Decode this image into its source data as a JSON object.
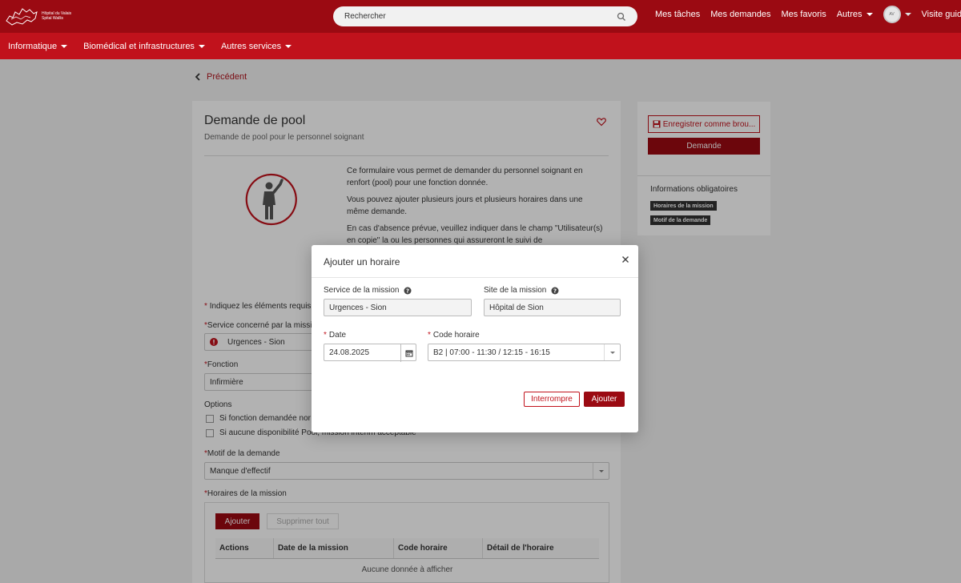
{
  "header": {
    "logo_line1": "Hôpital du Valais",
    "logo_line2": "Spital Wallis",
    "search_placeholder": "Rechercher",
    "nav": [
      "Mes tâches",
      "Mes demandes",
      "Mes favoris",
      "Autres"
    ],
    "avatar_initials": "AV",
    "guided_tour": "Visite guidée"
  },
  "subnav": [
    "Informatique",
    "Biomédical et infrastructures",
    "Autres services"
  ],
  "page": {
    "back_label": "Précédent",
    "title": "Demande de pool",
    "subtitle": "Demande de pool pour le personnel soignant",
    "intro": [
      "Ce formulaire vous permet de demander du personnel soignant en renfort (pool) pour une fonction donnée.",
      "Vous pouvez ajouter plusieurs jours et plusieurs horaires dans une même demande.",
      "En cas d'absence prévue, veuillez indiquer dans le champ \"Utilisateur(s) en copie\" la ou les personnes qui assureront le suivi de"
    ],
    "required_note": "Indiquez les éléments requis",
    "service_label": "Service concerné par la missi",
    "service_value": "Urgences - Sion",
    "fonction_label": "Fonction",
    "fonction_value": "Infirmière",
    "options_label": "Options",
    "option1": "Si fonction demandée nor",
    "option2": "Si aucune disponibilité Pool, mission intérim acceptable",
    "motif_label": "Motif de la demande",
    "motif_value": "Manque d'effectif",
    "horaires_label": "Horaires de la mission",
    "add_btn": "Ajouter",
    "delete_all_btn": "Supprimer tout",
    "table_headers": [
      "Actions",
      "Date de la mission",
      "Code horaire",
      "Détail de l'horaire"
    ],
    "table_empty": "Aucune donnée à afficher"
  },
  "sidebar": {
    "save_draft": "Enregistrer comme brou...",
    "submit": "Demande",
    "mandatory_title": "Informations obligatoires",
    "badges": [
      "Horaires de la mission",
      "Motif de la demande"
    ]
  },
  "modal": {
    "title": "Ajouter un horaire",
    "service_label": "Service de la mission",
    "service_value": "Urgences - Sion",
    "site_label": "Site de la mission",
    "site_value": "Hôpital de Sion",
    "date_label": "Date",
    "date_value": "24.08.2025",
    "code_label": "Code horaire",
    "code_value": "B2 | 07:00 - 11:30 / 12:15 - 16:15",
    "cancel_btn": "Interrompre",
    "add_btn": "Ajouter"
  },
  "colors": {
    "brand_dark": "#9b0a12",
    "brand": "#c1121c"
  }
}
